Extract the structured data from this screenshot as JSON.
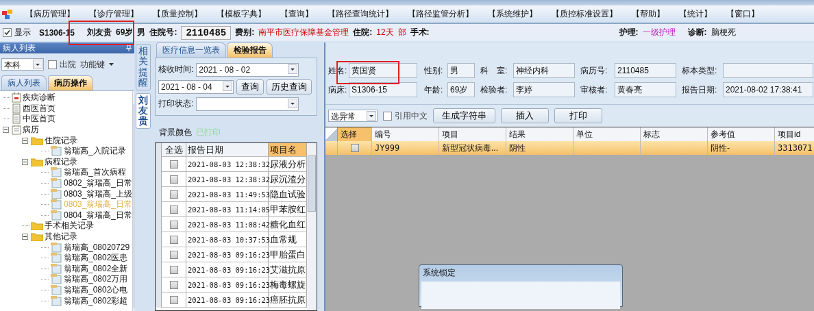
{
  "menu": [
    "【病历管理】",
    "【诊疗管理】",
    "【质量控制】",
    "【模板字典】",
    "【查询】",
    "【路径查询统计】",
    "【路径监管分析】",
    "【系统维护】",
    "【质控标准设置】",
    "【帮助】",
    "【统计】",
    "【窗口】"
  ],
  "patient_bar": {
    "show": {
      "label": "显示",
      "checked": true
    },
    "bed": "S1306-15",
    "name": "刘友贵",
    "age": "69岁",
    "sex": "男",
    "admission_label": "住院号:",
    "admission_no": "2110485",
    "fee_label": "费别:",
    "fee": "南平市医疗保障基金管理",
    "stay_label": "住院:",
    "stay": "12天",
    "stay_fragment": "部",
    "surgery_label": "手术:",
    "nursing_label": "护理:",
    "nursing": "一级护理",
    "diagnosis_label": "诊断:",
    "diagnosis": "脑梗死"
  },
  "left_panel": {
    "title": "病人列表",
    "dept": "本科",
    "discharged": {
      "label": "出院",
      "checked": false
    },
    "function_key": "功能键",
    "tabs": [
      {
        "label": "病人列表",
        "selected": false
      },
      {
        "label": "病历操作",
        "selected": true
      }
    ],
    "tree": [
      {
        "label": "疾病诊断",
        "kind": "diag",
        "selected": false
      },
      {
        "label": "西医首页",
        "kind": "page",
        "selected": false
      },
      {
        "label": "中医首页",
        "kind": "page",
        "selected": false
      },
      {
        "label": "病历",
        "kind": "record",
        "selected": false,
        "expanded": true,
        "children": [
          {
            "label": "住院记录",
            "kind": "folder",
            "selected": false,
            "expanded": true,
            "children": [
              {
                "label": "翁瑞高_入院记录",
                "kind": "doc",
                "selected": false
              }
            ]
          },
          {
            "label": "病程记录",
            "kind": "folder",
            "selected": false,
            "expanded": true,
            "children": [
              {
                "label": "翁瑞高_首次病程",
                "kind": "doc",
                "selected": false
              },
              {
                "label": "0802_翁瑞高_日常",
                "kind": "doc",
                "selected": false
              },
              {
                "label": "0803_翁瑞高_上级",
                "kind": "doc",
                "selected": false
              },
              {
                "label": "0803_翁瑞高_日常",
                "kind": "doc",
                "selected": true
              },
              {
                "label": "0804_翁瑞高_日常",
                "kind": "doc",
                "selected": false
              }
            ]
          },
          {
            "label": "手术相关记录",
            "kind": "folder",
            "selected": false
          },
          {
            "label": "其他记录",
            "kind": "folder",
            "selected": false,
            "expanded": true,
            "children": [
              {
                "label": "翁瑞高_08020729",
                "kind": "doc",
                "selected": false
              },
              {
                "label": "翁瑞高_0802医患",
                "kind": "doc",
                "selected": false
              },
              {
                "label": "翁瑞高_0802全新",
                "kind": "doc",
                "selected": false
              },
              {
                "label": "翁瑞高_0802万用",
                "kind": "doc",
                "selected": false
              },
              {
                "label": "翁瑞高_0802心电",
                "kind": "doc",
                "selected": false
              },
              {
                "label": "翁瑞高_0802彩超",
                "kind": "doc",
                "selected": false
              }
            ]
          }
        ]
      }
    ]
  },
  "side_tabs": [
    {
      "label": "相关提醒",
      "selected": false
    },
    {
      "label": "刘友贵",
      "selected": true
    }
  ],
  "middle": {
    "tabs": [
      {
        "label": "医疗信息一览表",
        "selected": false
      },
      {
        "label": "检验报告",
        "selected": true
      }
    ],
    "receive_label": "核收时间:",
    "date_from": "2021 - 08 - 02",
    "date_to": "2021 - 08 - 04",
    "query": "查询",
    "history": "历史查询",
    "print_label": "打印状态:",
    "legend_label": "背景颜色",
    "legend_printed": "已打印",
    "columns": [
      "全选",
      "报告日期",
      "项目名"
    ],
    "rows": [
      {
        "checked": false,
        "date": "2021-08-03 12:38:32",
        "item": "尿液分析"
      },
      {
        "checked": false,
        "date": "2021-08-03 12:38:32",
        "item": "尿沉渣分"
      },
      {
        "checked": false,
        "date": "2021-08-03 11:49:53",
        "item": "隐血试验"
      },
      {
        "checked": false,
        "date": "2021-08-03 11:14:05",
        "item": "甲苯胺红"
      },
      {
        "checked": false,
        "date": "2021-08-03 11:08:42",
        "item": "糖化血红"
      },
      {
        "checked": false,
        "date": "2021-08-03 10:37:53",
        "item": "血常规"
      },
      {
        "checked": false,
        "date": "2021-08-03 09:16:23",
        "item": "甲胎蛋白"
      },
      {
        "checked": false,
        "date": "2021-08-03 09:16:23",
        "item": "艾滋抗原"
      },
      {
        "checked": false,
        "date": "2021-08-03 09:16:23",
        "item": "梅毒螺旋"
      },
      {
        "checked": false,
        "date": "2021-08-03 09:16:23",
        "item": "癌胚抗原"
      }
    ]
  },
  "report": {
    "fields": [
      {
        "label": "姓名:",
        "value": "黄国贤"
      },
      {
        "label": "性别:",
        "value": "男"
      },
      {
        "label": "科　室:",
        "value": "神经内科"
      },
      {
        "label": "病历号:",
        "value": "2110485"
      },
      {
        "label": "标本类型:"
      },
      {
        "label": "病床:",
        "value": "S1306-15"
      },
      {
        "label": "年龄:",
        "value": "69岁"
      },
      {
        "label": "检验者:",
        "value": "李婷"
      },
      {
        "label": "审核者:",
        "value": "黄春亮"
      },
      {
        "label": "报告日期:",
        "value": "2021-08-02 17:38:41"
      }
    ],
    "filter": "选异常",
    "use_chinese": {
      "label": "引用中文",
      "checked": false
    },
    "buttons": [
      "生成字符串",
      "插入",
      "打印"
    ],
    "select_column": "选择",
    "columns": [
      "编号",
      "项目",
      "结果",
      "单位",
      "标志",
      "参考值",
      "项目id"
    ],
    "rows": [
      {
        "selected": true,
        "checked": false,
        "cells": [
          "JY999",
          "新型冠状病毒...",
          "阴性",
          "",
          "",
          "阴性-",
          "3313071"
        ]
      }
    ]
  },
  "dialog": {
    "title": "系统锁定"
  }
}
